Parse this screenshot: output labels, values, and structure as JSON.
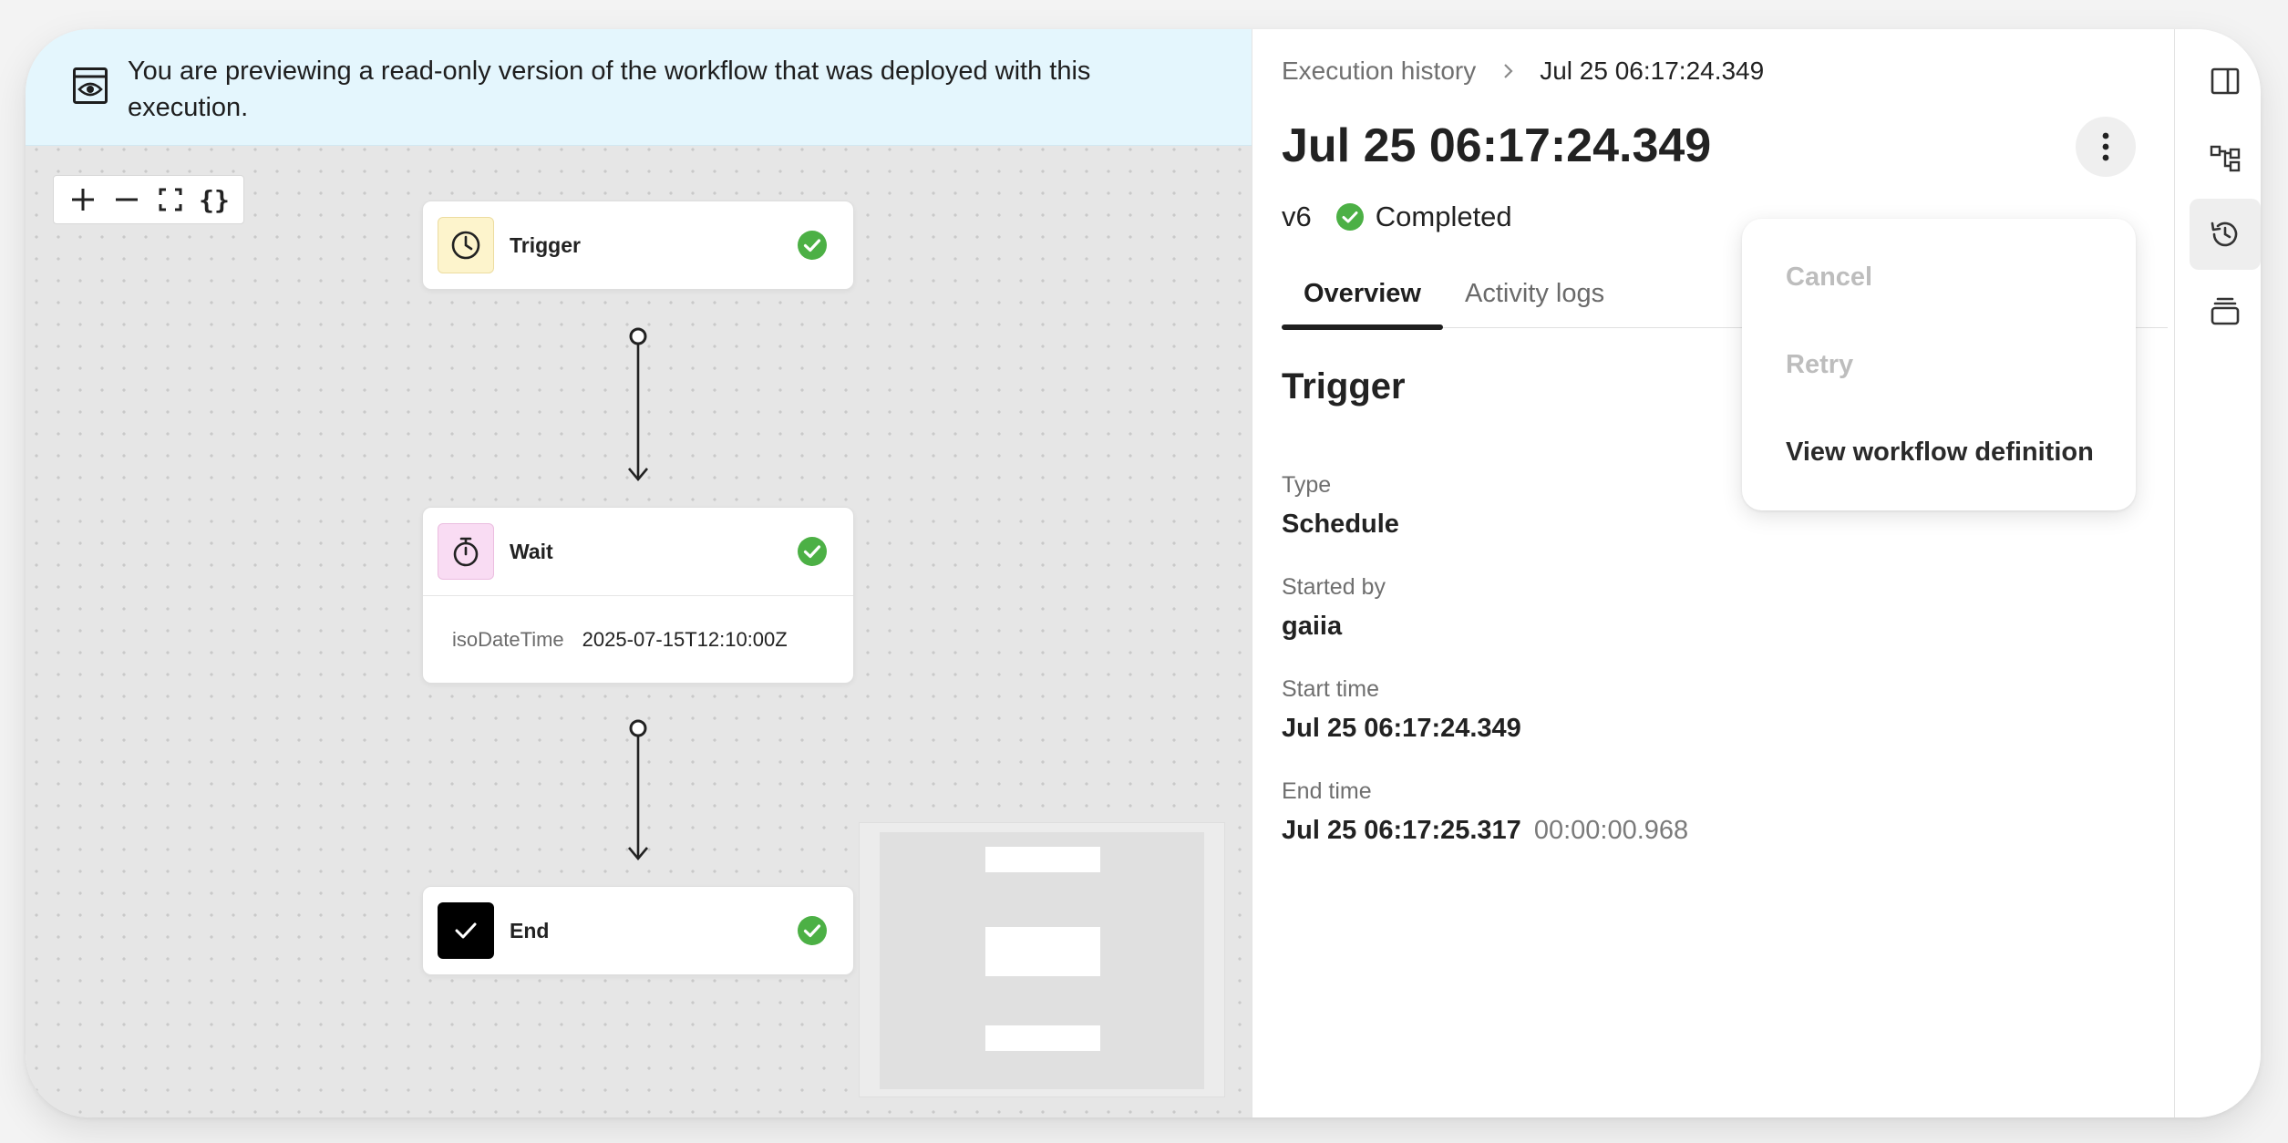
{
  "banner": {
    "message": "You are previewing a read-only version of the workflow that was deployed with this execution."
  },
  "zoom_controls": {
    "fit_label": "{}"
  },
  "workflow": {
    "nodes": [
      {
        "label": "Trigger",
        "icon": "clock-icon",
        "icon_bg": "#fdf4cc",
        "status": "completed"
      },
      {
        "label": "Wait",
        "icon": "stopwatch-icon",
        "icon_bg": "#f9dcf3",
        "status": "completed",
        "param_key": "isoDateTime",
        "param_value": "2025-07-15T12:10:00Z"
      },
      {
        "label": "End",
        "icon": "check-square-icon",
        "icon_bg": "#000000",
        "status": "completed"
      }
    ]
  },
  "details": {
    "breadcrumb_parent": "Execution history",
    "breadcrumb_current": "Jul 25 06:17:24.349",
    "title": "Jul 25 06:17:24.349",
    "version": "v6",
    "status": "Completed",
    "tabs": [
      "Overview",
      "Activity logs"
    ],
    "section_title": "Trigger",
    "fields": {
      "type_label": "Type",
      "type_value": "Schedule",
      "started_by_label": "Started by",
      "started_by_value": "gaiia",
      "start_time_label": "Start time",
      "start_time_value": "Jul 25 06:17:24.349",
      "end_time_label": "End time",
      "end_time_value": "Jul 25 06:17:25.317",
      "duration": "00:00:00.968"
    }
  },
  "menu": {
    "cancel": "Cancel",
    "retry": "Retry",
    "view_definition": "View workflow definition"
  },
  "colors": {
    "success": "#4cb045",
    "banner_bg": "#e4f6fd"
  }
}
